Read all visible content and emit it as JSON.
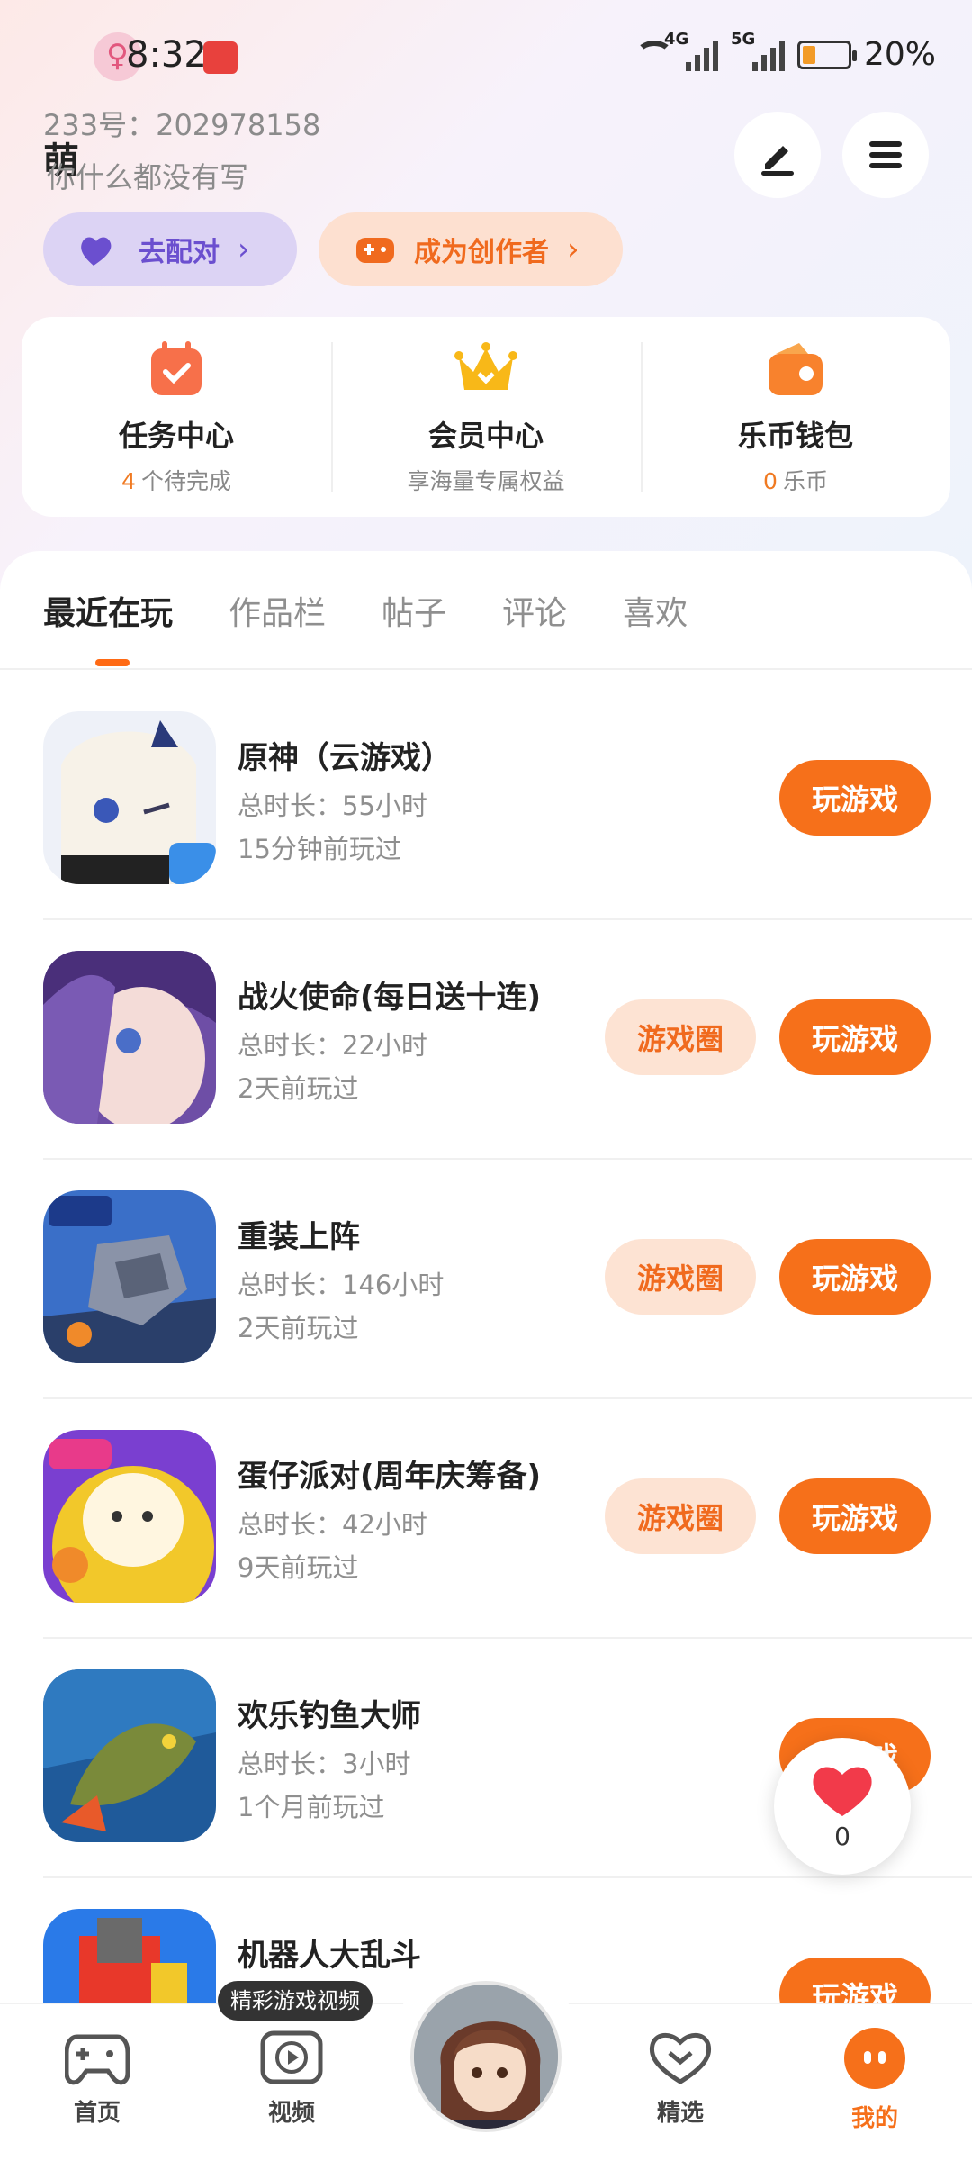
{
  "status_bar": {
    "time": "8:32",
    "net1": "4G",
    "net2": "5G",
    "battery": "20%"
  },
  "profile": {
    "uid": "233号：202978158",
    "nickname": "萌",
    "bio": "你什么都没有写"
  },
  "pills": {
    "match": "去配对",
    "creator": "成为创作者"
  },
  "stats": [
    {
      "title": "任务中心",
      "num": "4",
      "sub": "个待完成"
    },
    {
      "title": "会员中心",
      "num": "",
      "sub": "享海量专属权益"
    },
    {
      "title": "乐币钱包",
      "num": "0",
      "sub": "乐币"
    }
  ],
  "tabs": [
    "最近在玩",
    "作品栏",
    "帖子",
    "评论",
    "喜欢"
  ],
  "games": [
    {
      "name": "原神（云游戏）",
      "time": "总时长：55小时",
      "last": "15分钟前玩过",
      "play": "玩游戏",
      "circle": ""
    },
    {
      "name": "战火使命(每日送十连)",
      "time": "总时长：22小时",
      "last": "2天前玩过",
      "play": "玩游戏",
      "circle": "游戏圈"
    },
    {
      "name": "重装上阵",
      "time": "总时长：146小时",
      "last": "2天前玩过",
      "play": "玩游戏",
      "circle": "游戏圈"
    },
    {
      "name": "蛋仔派对(周年庆筹备)",
      "time": "总时长：42小时",
      "last": "9天前玩过",
      "play": "玩游戏",
      "circle": "游戏圈"
    },
    {
      "name": "欢乐钓鱼大师",
      "time": "总时长：3小时",
      "last": "1个月前玩过",
      "play": "玩游戏",
      "circle": ""
    },
    {
      "name": "机器人大乱斗",
      "time": "",
      "last": "",
      "play": "玩游戏",
      "circle": ""
    }
  ],
  "float_like": {
    "count": "0"
  },
  "nav": {
    "home": "首页",
    "video": "视频",
    "video_tip": "精彩游戏视频",
    "pick": "精选",
    "me": "我的"
  },
  "colors": {
    "accent": "#f6701a",
    "accent_light": "#fde3d3",
    "purple": "#6b4fcf"
  }
}
